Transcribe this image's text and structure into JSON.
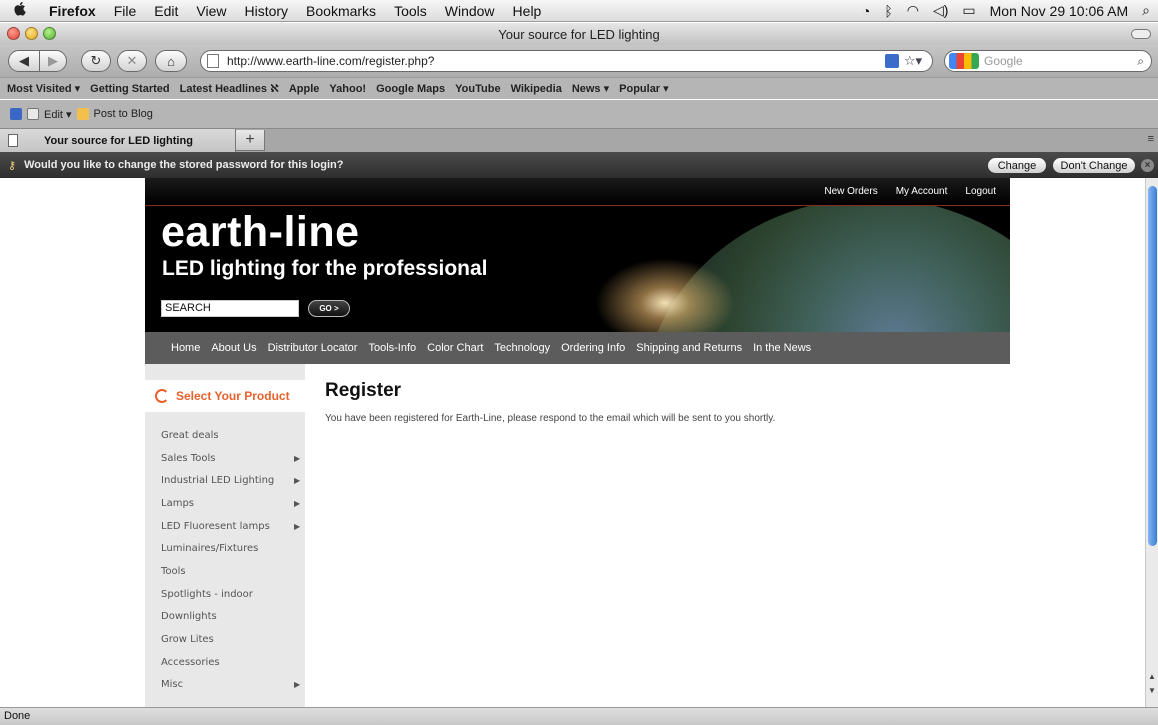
{
  "menubar": {
    "apple": "",
    "app": "Firefox",
    "items": [
      "File",
      "Edit",
      "View",
      "History",
      "Bookmarks",
      "Tools",
      "Window",
      "Help"
    ],
    "clock": "Mon Nov 29  10:06 AM"
  },
  "window": {
    "title": "Your source for LED lighting"
  },
  "toolbar": {
    "url": "http://www.earth-line.com/register.php?",
    "search_placeholder": "Google"
  },
  "bookmarks": [
    "Most Visited ▾",
    "Getting Started",
    "Latest Headlines ℵ",
    "Apple",
    "Yahoo!",
    "Google Maps",
    "YouTube",
    "Wikipedia",
    "News ▾",
    "Popular ▾"
  ],
  "addonbar": {
    "edit": "Edit ▾",
    "post": "Post to Blog"
  },
  "tab": {
    "title": "Your source for LED lighting",
    "new_tab": "+"
  },
  "notification": {
    "message": "Would you like to change the stored password for this login?",
    "change": "Change",
    "dont_change": "Don't Change"
  },
  "site": {
    "toplinks": [
      "New Orders",
      "My Account",
      "Logout"
    ],
    "logo": "earth-line",
    "tagline": "LED lighting for the professional",
    "search_value": "SEARCH",
    "go": "GO >",
    "nav": [
      "Home",
      "About Us",
      "Distributor Locator",
      "Tools-Info",
      "Color Chart",
      "Technology",
      "Ordering Info",
      "Shipping and Returns",
      "In the News"
    ],
    "sidebar": {
      "heading": "Select Your Product",
      "items": [
        {
          "label": "Great deals",
          "arrow": ""
        },
        {
          "label": "Sales Tools",
          "arrow": "▶"
        },
        {
          "label": "Industrial LED Lighting",
          "arrow": "▶"
        },
        {
          "label": "Lamps",
          "arrow": "▶"
        },
        {
          "label": "LED Fluoresent lamps",
          "arrow": "▶"
        },
        {
          "label": "Luminaires/Fixtures",
          "arrow": ""
        },
        {
          "label": "Tools",
          "arrow": ""
        },
        {
          "label": "Spotlights - indoor",
          "arrow": ""
        },
        {
          "label": "Downlights",
          "arrow": ""
        },
        {
          "label": "Grow Lites",
          "arrow": ""
        },
        {
          "label": "Accessories",
          "arrow": ""
        },
        {
          "label": "Misc",
          "arrow": "▶"
        }
      ]
    },
    "heading": "Register",
    "message": "You have been registered for Earth-Line, please respond to the email which will be sent to you shortly."
  },
  "status": "Done"
}
